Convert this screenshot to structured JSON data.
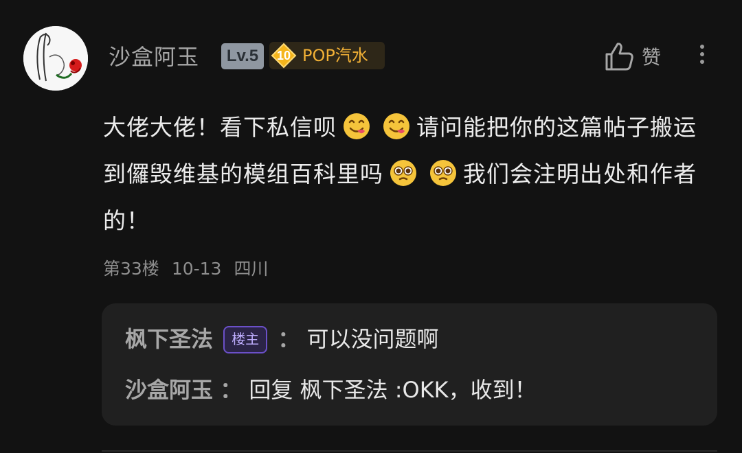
{
  "comment": {
    "username": "沙盒阿玉",
    "level": "Lv.5",
    "badge": {
      "number": "10",
      "label": "POP汽水"
    },
    "like_label": "赞",
    "text_parts": [
      "大佬大佬！看下私信呗",
      "请问能把你的这篇帖子搬运到儸毁维基的模组百科里吗",
      "我们会注明出处和作者的！"
    ],
    "floor": "第33楼",
    "date": "10-13",
    "location": "四川"
  },
  "replies": [
    {
      "name": "枫下圣法",
      "owner_tag": "楼主",
      "separator": "：",
      "text": "可以没问题啊"
    },
    {
      "name": "沙盒阿玉",
      "separator": "：",
      "text": "回复 枫下圣法 :OKK，收到！"
    }
  ],
  "colors": {
    "background": "#121212",
    "reply_background": "#202020",
    "badge_text": "#f2b136",
    "owner_tag": "#bfaeff"
  },
  "icons": [
    "avatar",
    "thumbs-up-icon",
    "more-vertical-icon",
    "yum-face-icon",
    "pleading-face-icon"
  ]
}
